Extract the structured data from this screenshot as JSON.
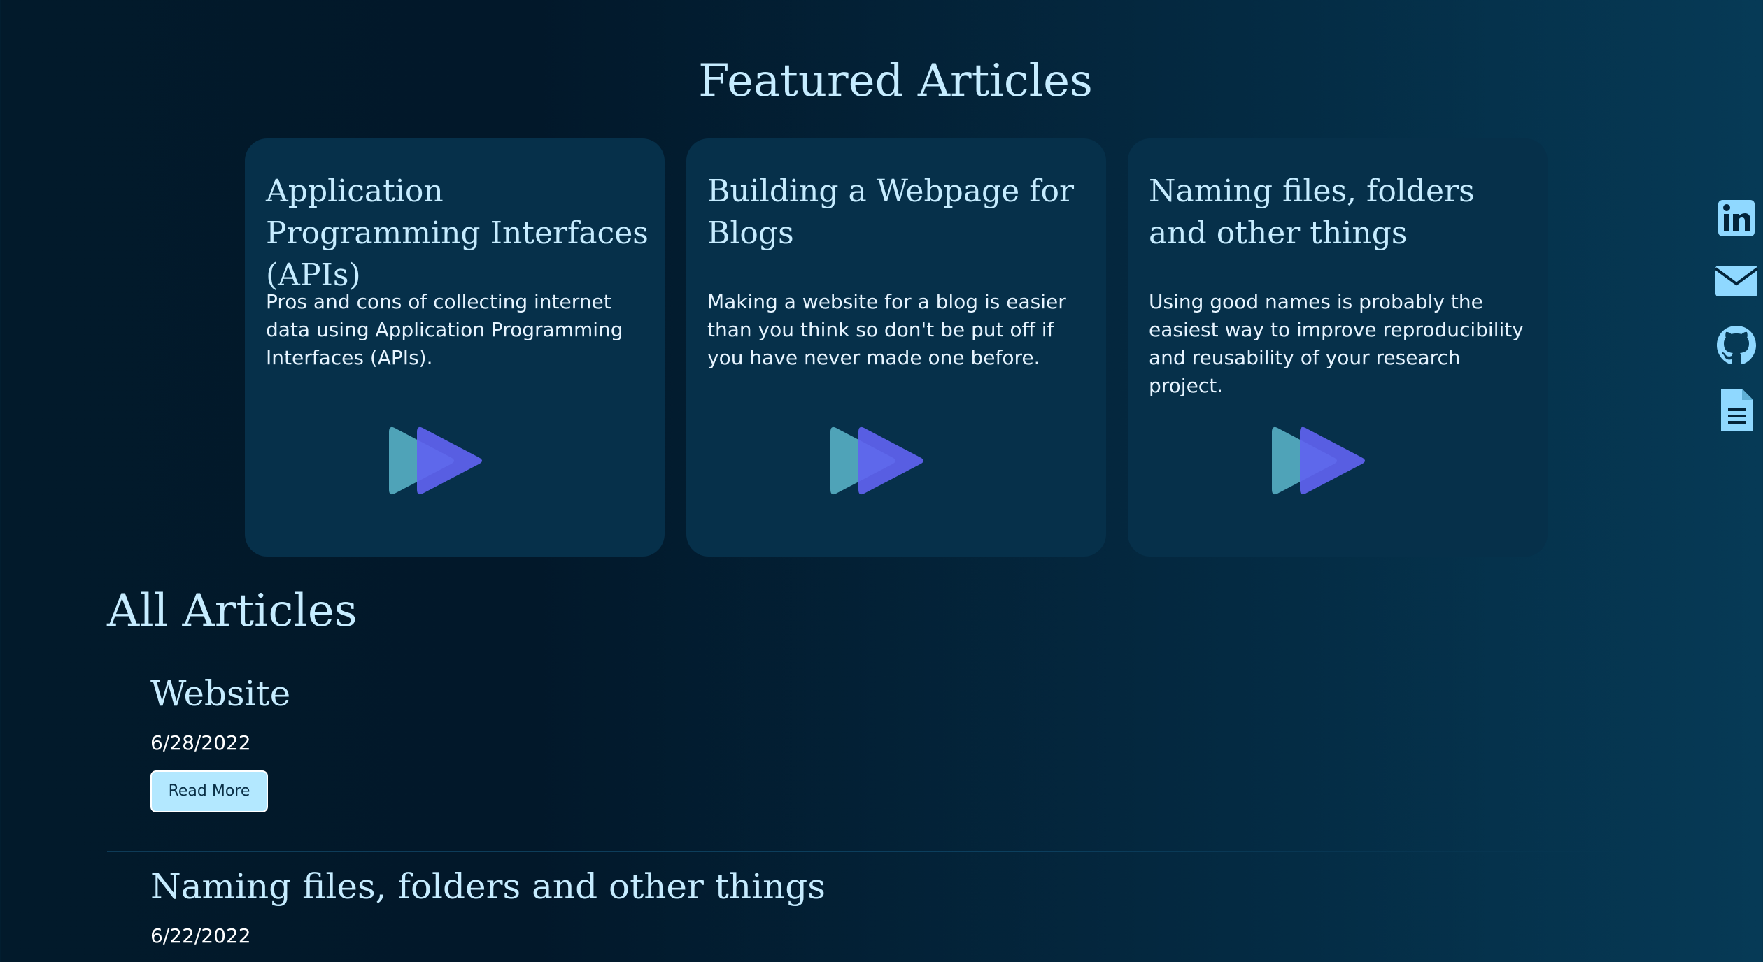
{
  "featured": {
    "title": "Featured Articles",
    "cards": [
      {
        "title": "Application Programming Interfaces (APIs)",
        "description": "Pros and cons of collecting internet data using Application Programming Interfaces (APIs).",
        "logo_icon": "double-play-logo-icon"
      },
      {
        "title": "Building a Webpage for Blogs",
        "description": "Making a website for a blog is easier than you think so don't be put off if you have never made one before.",
        "logo_icon": "double-play-logo-icon"
      },
      {
        "title": "Naming files, folders and other things",
        "description": "Using good names is probably the easiest way to improve reproducibility and reusability of your research project.",
        "logo_icon": "double-play-logo-icon"
      }
    ]
  },
  "all_articles": {
    "title": "All Articles",
    "items": [
      {
        "title": "Website",
        "date": "6/28/2022",
        "button_label": "Read More"
      },
      {
        "title": "Naming files, folders and other things",
        "date": "6/22/2022"
      }
    ]
  },
  "social": {
    "icons": [
      "linkedin-icon",
      "email-icon",
      "github-icon",
      "document-icon"
    ]
  },
  "colors": {
    "heading": "#c6ecff",
    "card_background": "#06304a",
    "button_background": "#b3e8ff",
    "icon": "#8fd8ff",
    "logo_back": "#4fa3b8",
    "logo_front": "#5f63ef"
  }
}
